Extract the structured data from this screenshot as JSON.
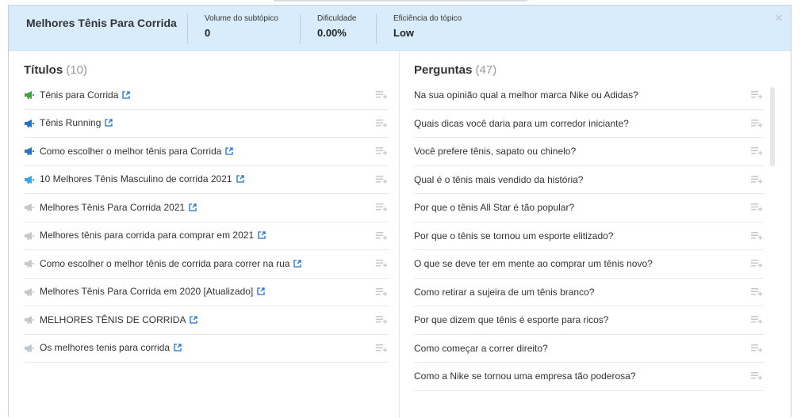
{
  "header": {
    "title": "Melhores Tênis Para Corrida",
    "metrics": [
      {
        "label": "Volume do subtópico",
        "value": "0"
      },
      {
        "label": "Dificuldade",
        "value": "0.00%"
      },
      {
        "label": "Eficiência do tópico",
        "value": "Low"
      }
    ],
    "close_glyph": "×"
  },
  "titles": {
    "heading": "Títulos",
    "count": "(10)",
    "items": [
      {
        "label": "Tênis para Corrida",
        "icon_color": "#3aa346",
        "icon": "megaphone-icon"
      },
      {
        "label": "Tênis Running",
        "icon_color": "#1f74c9",
        "icon": "megaphone-icon"
      },
      {
        "label": "Como escolher o melhor tênis para Corrida",
        "icon_color": "#1f74c9",
        "icon": "megaphone-icon"
      },
      {
        "label": "10 Melhores Tênis Masculino de corrida 2021",
        "icon_color": "#31a9e0",
        "icon": "megaphone-icon"
      },
      {
        "label": "Melhores Tênis Para Corrida 2021",
        "icon_color": "#c3c8cd",
        "icon": "megaphone-icon"
      },
      {
        "label": "Melhores tênis para corrida para comprar em 2021",
        "icon_color": "#c3c8cd",
        "icon": "megaphone-icon"
      },
      {
        "label": "Como escolher o melhor tênis de corrida para correr na rua",
        "icon_color": "#c3c8cd",
        "icon": "megaphone-icon"
      },
      {
        "label": "Melhores Tênis Para Corrida em 2020 [Atualizado]",
        "icon_color": "#c3c8cd",
        "icon": "megaphone-icon"
      },
      {
        "label": "MELHORES TÊNIS DE CORRIDA",
        "icon_color": "#c3c8cd",
        "icon": "megaphone-icon"
      },
      {
        "label": "Os melhores tenis para corrida",
        "icon_color": "#c3c8cd",
        "icon": "megaphone-icon"
      }
    ]
  },
  "questions": {
    "heading": "Perguntas",
    "count": "(47)",
    "items": [
      "Na sua opinião qual a melhor marca Nike ou Adidas?",
      "Quais dicas você daria para um corredor iniciante?",
      "Você prefere tênis, sapato ou chinelo?",
      "Qual é o tênis mais vendido da história?",
      "Por que o tênis All Star é tão popular?",
      "Por que o tênis se tornou um esporte elitizado?",
      "O que se deve ter em mente ao comprar um tênis novo?",
      "Como retirar a sujeira de um tênis branco?",
      "Por que dizem que tênis é esporte para ricos?",
      "Como começar a correr direito?",
      "Como a Nike se tornou uma empresa tão poderosa?"
    ]
  },
  "colors": {
    "header_bg": "#d9ecfb",
    "link_icon": "#1f74c9",
    "add_icon": "#c3c8cd"
  }
}
